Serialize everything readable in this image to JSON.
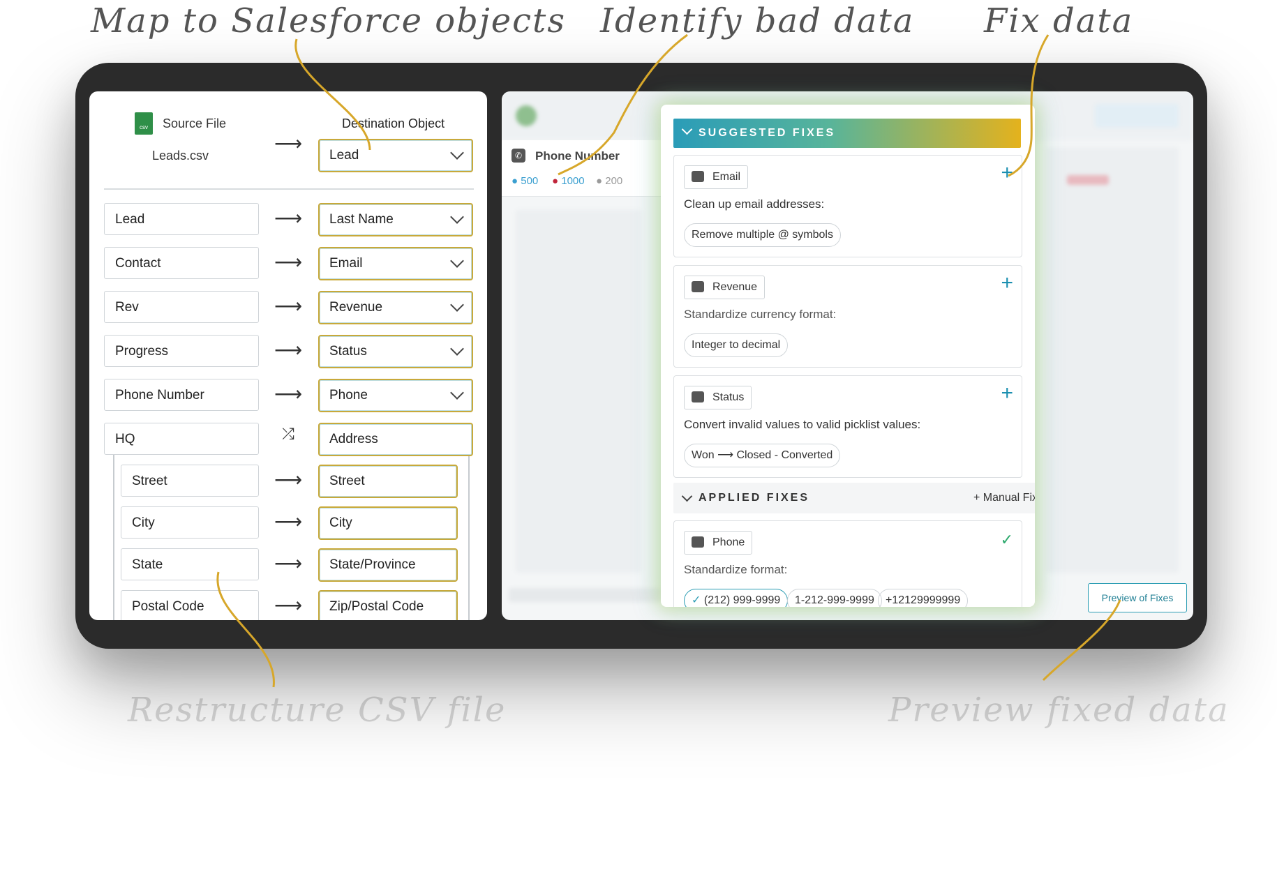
{
  "annotations": {
    "map": "Map to Salesforce objects",
    "identify": "Identify bad data",
    "fix": "Fix data",
    "restructure": "Restructure CSV file",
    "preview": "Preview fixed data"
  },
  "mapping": {
    "source_label": "Source File",
    "source_icon_text": "csv",
    "source_file": "Leads.csv",
    "dest_label": "Destination Object",
    "dest_value": "Lead",
    "rows": [
      {
        "source": "Lead",
        "dest": "Last Name"
      },
      {
        "source": "Contact",
        "dest": "Email"
      },
      {
        "source": "Rev",
        "dest": "Revenue"
      },
      {
        "source": "Progress",
        "dest": "Status"
      },
      {
        "source": "Phone Number",
        "dest": "Phone"
      },
      {
        "source": "HQ",
        "dest": "Address"
      }
    ],
    "subrows": [
      {
        "source": "Street",
        "dest": "Street"
      },
      {
        "source": "City",
        "dest": "City"
      },
      {
        "source": "State",
        "dest": "State/Province"
      },
      {
        "source": "Postal Code",
        "dest": "Zip/Postal Code"
      }
    ]
  },
  "profile": {
    "column": "Phone Number",
    "counts": [
      "500",
      "1000",
      "200"
    ],
    "colors": {
      "valid": "#3a9fd0",
      "invalid": "#c0253a",
      "empty": "#9a9a9a"
    }
  },
  "suggested": {
    "header": "SUGGESTED FIXES",
    "cards": [
      {
        "tag": "Email",
        "text": "Clean up email addresses:",
        "pills": [
          "Remove multiple @ symbols"
        ]
      },
      {
        "tag": "Revenue",
        "text": "Standardize currency format:",
        "pills": [
          "Integer to decimal"
        ]
      },
      {
        "tag": "Status",
        "text": "Convert invalid values to valid picklist values:",
        "pill_from": "Won",
        "pill_to": "Closed - Converted"
      }
    ]
  },
  "applied": {
    "header": "APPLIED FIXES",
    "manual": "Manual Fix",
    "card": {
      "tag": "Phone",
      "text": "Standardize format:",
      "pills": [
        "(212) 999-9999",
        "1-212-999-9999",
        "+12129999999"
      ]
    }
  },
  "preview_button": "Preview of Fixes"
}
